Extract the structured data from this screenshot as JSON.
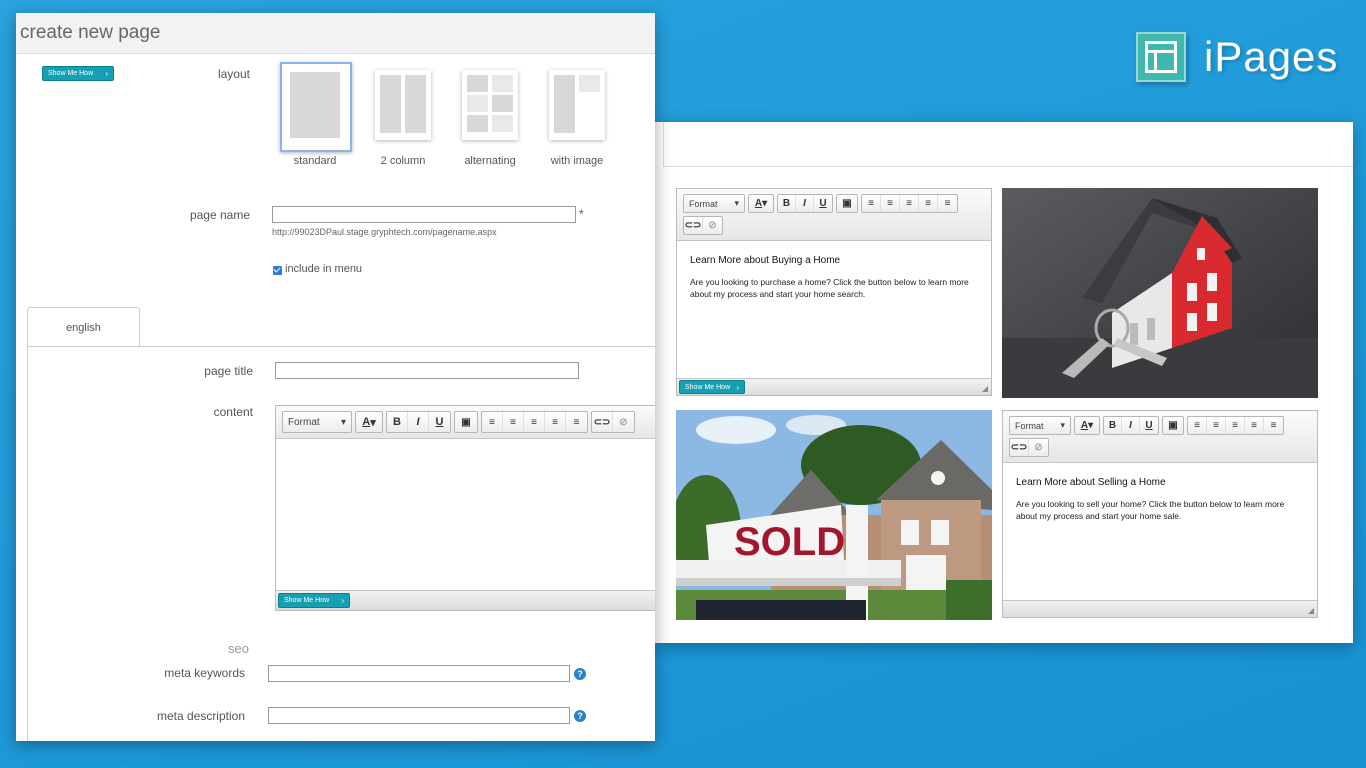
{
  "brand": {
    "name": "iPages",
    "icon": "layout-grid-icon",
    "color": "#3fb9b0"
  },
  "form": {
    "title": "create new page",
    "show_me_how": "Show Me How",
    "layout": {
      "label": "layout",
      "options": [
        {
          "id": "standard",
          "label": "standard",
          "selected": true
        },
        {
          "id": "2column",
          "label": "2 column",
          "selected": false
        },
        {
          "id": "alternating",
          "label": "alternating",
          "selected": false
        },
        {
          "id": "with_image",
          "label": "with image",
          "selected": false
        }
      ]
    },
    "page_name": {
      "label": "page name",
      "value": "",
      "required_mark": "*",
      "url_hint": "http://99023DPaul.stage.gryphtech.com/pagename.aspx"
    },
    "include_in_menu": {
      "label": "include in menu",
      "checked": true
    },
    "tabs": [
      {
        "label": "english",
        "active": true
      }
    ],
    "page_title": {
      "label": "page title",
      "value": ""
    },
    "content": {
      "label": "content"
    },
    "seo": {
      "heading": "seo",
      "meta_keywords": {
        "label": "meta keywords",
        "value": ""
      },
      "meta_description": {
        "label": "meta description",
        "value": ""
      }
    }
  },
  "editor_toolbar": {
    "format_label": "Format",
    "font_color": "A",
    "bold": "B",
    "italic": "I",
    "underline": "U"
  },
  "preview": {
    "buying": {
      "heading": "Learn More about Buying a Home",
      "body": "Are you looking to purchase a home? Click the button below to learn more about my process and start your home search.",
      "show_me_how": "Show Me How"
    },
    "selling": {
      "heading": "Learn More about Selling a Home",
      "body": "Are you looking to sell your home? Click the button below to learn more about my process and start your home sale."
    },
    "sold_sign": "SOLD"
  },
  "colors": {
    "background": "#1e9ad9",
    "accent_teal": "#16a0b3",
    "help_blue": "#2a82c7",
    "sold_red": "#a3172e",
    "house_red": "#d82a2f"
  }
}
